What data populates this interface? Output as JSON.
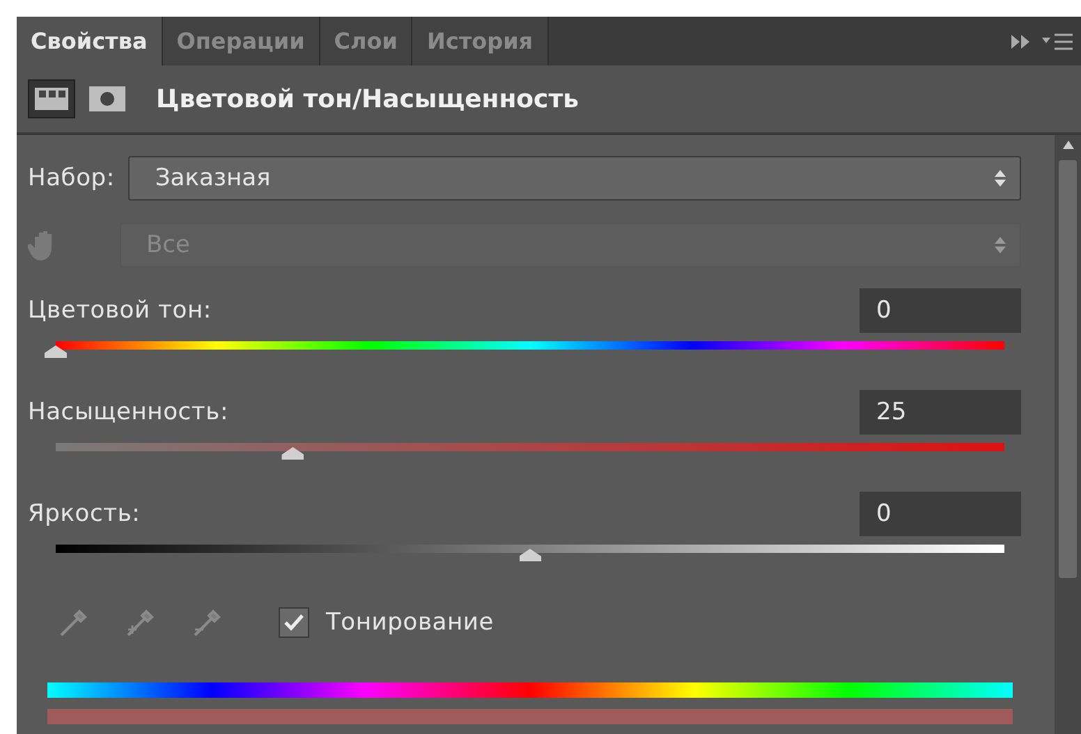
{
  "tabs": [
    {
      "label": "Свойства",
      "selected": true
    },
    {
      "label": "Операции",
      "selected": false
    },
    {
      "label": "Слои",
      "selected": false
    },
    {
      "label": "История",
      "selected": false
    }
  ],
  "header": {
    "title": "Цветовой тон/Насыщенность"
  },
  "preset": {
    "label": "Набор:",
    "value": "Заказная"
  },
  "range": {
    "value": "Все",
    "disabled": true
  },
  "sliders": [
    {
      "kind": "hue",
      "label": "Цветовой тон:",
      "value": "0",
      "level": 0
    },
    {
      "kind": "saturation",
      "label": "Насыщенность:",
      "value": "25",
      "level": 0.25
    },
    {
      "kind": "lightness",
      "label": "Яркость:",
      "value": "0",
      "level": 0.5
    }
  ],
  "colorize": {
    "label": "Тонирование",
    "checked": true
  }
}
